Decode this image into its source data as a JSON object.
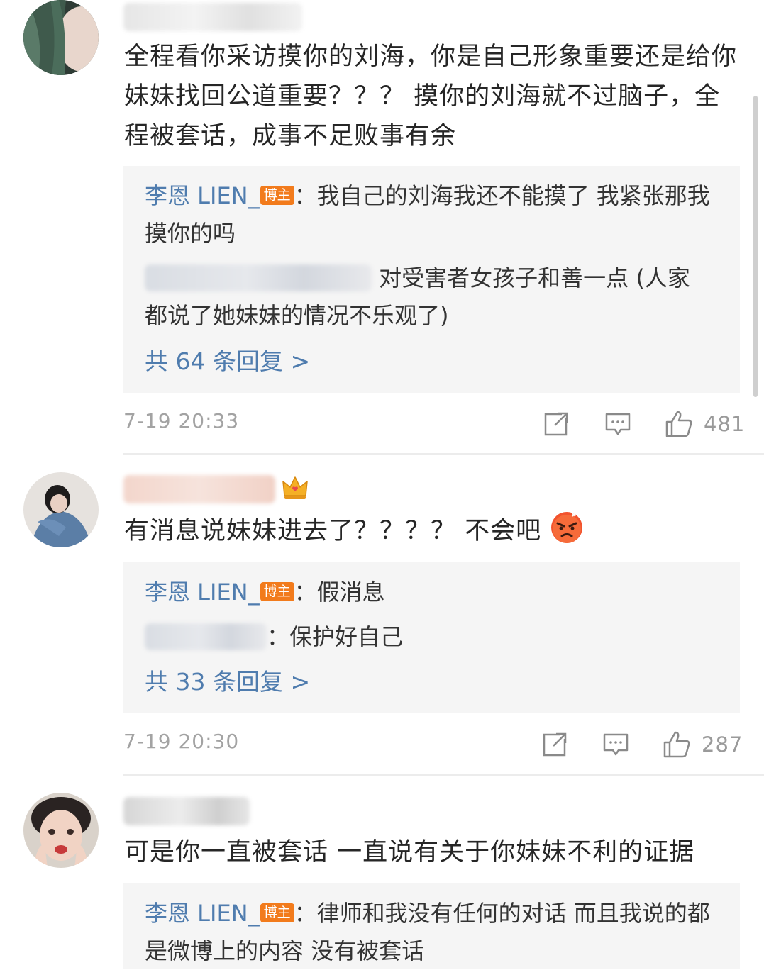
{
  "comments": [
    {
      "text": "全程看你采访摸你的刘海，你是自己形象重要还是给你妹妹找回公道重要？？？ 摸你的刘海就不过脑子，全程被套话，成事不足败事有余",
      "replies": [
        {
          "author": "李恩 LIEN_",
          "badge": "博主",
          "text": "：我自己的刘海我还不能摸了  我紧张那我摸你的吗"
        },
        {
          "text": "对受害者女孩子和善一点 (人家都说了她妹妹的情况不乐观了)"
        }
      ],
      "more_replies": "共 64 条回复 >",
      "time": "7-19 20:33",
      "likes": "481"
    },
    {
      "text": "有消息说妹妹进去了？？？？ 不会吧",
      "replies": [
        {
          "author": "李恩 LIEN_",
          "badge": "博主",
          "text": "：假消息"
        },
        {
          "text": "：保护好自己"
        }
      ],
      "more_replies": "共 33 条回复 >",
      "time": "7-19 20:30",
      "likes": "287"
    },
    {
      "text": "可是你一直被套话 一直说有关于你妹妹不利的证据",
      "replies": [
        {
          "author": "李恩 LIEN_",
          "badge": "博主",
          "text": "：律师和我没有任何的对话  而且我说的都是微博上的内容  没有被套话"
        }
      ]
    }
  ],
  "icons": {
    "share": "share-icon",
    "comment": "comment-icon",
    "like": "thumbs-up-icon",
    "vip": "crown-icon",
    "emoji": "angry-face-icon"
  },
  "colors": {
    "link": "#4f7cae",
    "badge": "#f27b1c",
    "reply_bg": "#f5f5f5",
    "meta": "#a3a3a3"
  }
}
